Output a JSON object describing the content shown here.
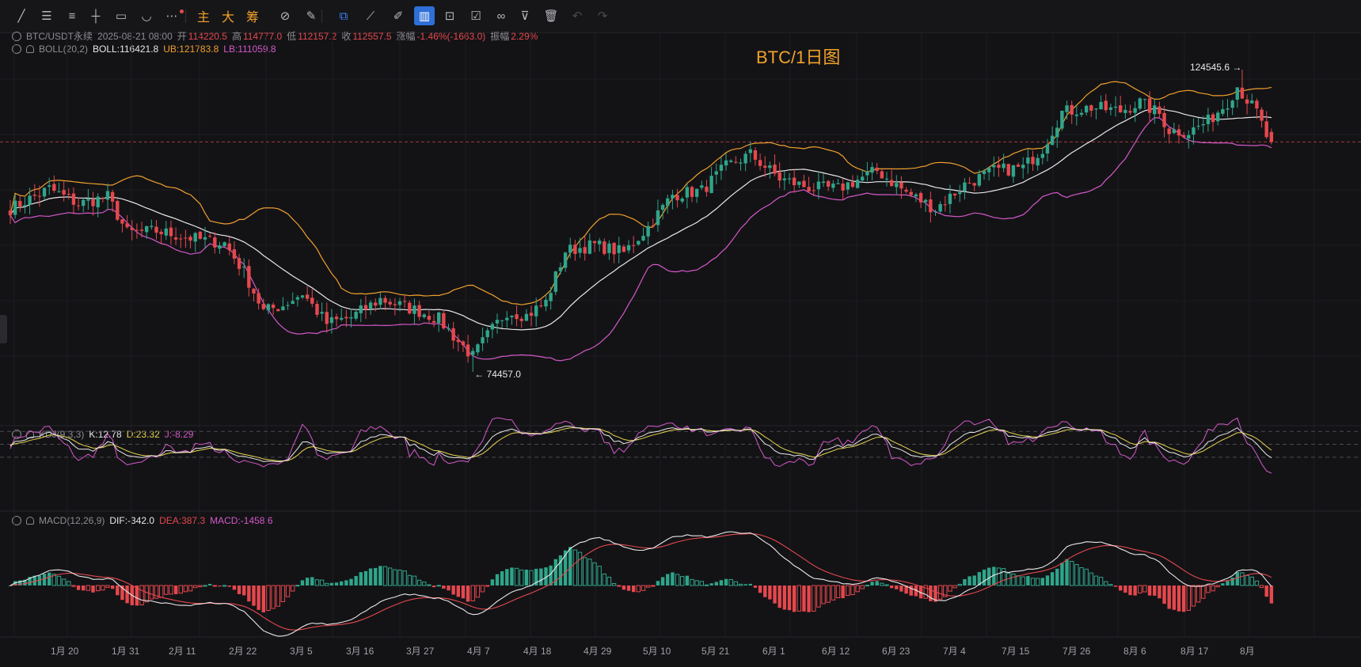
{
  "toolbar": {
    "tools": [
      {
        "name": "trend-line-icon",
        "glyph": "╱"
      },
      {
        "name": "parallel-lines-icon",
        "glyph": "☰"
      },
      {
        "name": "horizontal-lines-icon",
        "glyph": "≡"
      },
      {
        "name": "horizontal-ray-icon",
        "glyph": "┼"
      },
      {
        "name": "rectangle-icon",
        "glyph": "▭"
      },
      {
        "name": "curve-icon",
        "glyph": "◡"
      },
      {
        "name": "more-tools-icon",
        "glyph": "⋯"
      },
      {
        "name": "main-chart-button",
        "glyph": "主"
      },
      {
        "name": "large-button",
        "glyph": "大"
      },
      {
        "name": "chips-button",
        "glyph": "筹"
      },
      {
        "name": "magnet-icon",
        "glyph": "⊘"
      },
      {
        "name": "draw-toggle-icon",
        "glyph": "✎"
      },
      {
        "name": "copy-icon",
        "glyph": "⧉"
      },
      {
        "name": "ruler-icon",
        "glyph": "⟋"
      },
      {
        "name": "pen-icon",
        "glyph": "✐"
      },
      {
        "name": "candles-icon",
        "glyph": "▥"
      },
      {
        "name": "lock-icon",
        "glyph": "⊡"
      },
      {
        "name": "notes-icon",
        "glyph": "☑"
      },
      {
        "name": "link-icon",
        "glyph": "∞"
      },
      {
        "name": "filter-icon",
        "glyph": "⊽"
      },
      {
        "name": "delete-icon",
        "glyph": "🗑"
      },
      {
        "name": "undo-icon",
        "glyph": "↶"
      },
      {
        "name": "redo-icon",
        "glyph": "↷"
      }
    ]
  },
  "header": {
    "symbol": "BTC/USDT永续",
    "datetime": "2025-08-21 08:00",
    "open_label": "开",
    "open": "114220.5",
    "high_label": "高",
    "high": "114777.0",
    "low_label": "低",
    "low": "112157.2",
    "close_label": "收",
    "close": "112557.5",
    "change_label": "涨幅",
    "change": "-1.46%(-1663.0)",
    "amplitude_label": "振幅",
    "amplitude": "2.29%"
  },
  "boll": {
    "name": "BOLL(20,2)",
    "mid": "BOLL:116421.8",
    "ub": "UB:121783.8",
    "lb": "LB:111059.8"
  },
  "kdj": {
    "name": "KDJ(9,3,3)",
    "k": "K:12.78",
    "d": "D:23.32",
    "j": "J:-8.29"
  },
  "macd": {
    "name": "MACD(12,26,9)",
    "dif": "DIF:-342.0",
    "dea": "DEA:387.3",
    "macd": "MACD:-1458.6"
  },
  "chart_title": "BTC/1日图",
  "annotations": {
    "high": "124545.6 →",
    "low": "← 74457.0"
  },
  "colors": {
    "up": "#2fa58a",
    "down": "#e5484d",
    "boll_mid": "#e8e8ea",
    "boll_ub": "#f0a02c",
    "boll_lb": "#d558c8",
    "accent": "#f2a22a"
  },
  "chart_data": {
    "type": "candlestick",
    "x_ticks": [
      "1月 20",
      "1月 31",
      "2月 11",
      "2月 22",
      "3月 5",
      "3月 16",
      "3月 27",
      "4月 7",
      "4月 18",
      "4月 29",
      "5月 10",
      "5月 21",
      "6月 1",
      "6月 12",
      "6月 23",
      "7月 4",
      "7月 15",
      "7月 26",
      "8月 6",
      "8月 17",
      "8月"
    ],
    "close_anchors": [
      [
        0,
        101500
      ],
      [
        8,
        104800
      ],
      [
        14,
        102300
      ],
      [
        20,
        103500
      ],
      [
        24,
        97500
      ],
      [
        30,
        97800
      ],
      [
        38,
        96500
      ],
      [
        44,
        95800
      ],
      [
        48,
        91000
      ],
      [
        52,
        84500
      ],
      [
        56,
        85500
      ],
      [
        60,
        87500
      ],
      [
        65,
        82500
      ],
      [
        70,
        83500
      ],
      [
        76,
        86500
      ],
      [
        84,
        84500
      ],
      [
        88,
        83200
      ],
      [
        92,
        79500
      ],
      [
        95,
        77000
      ],
      [
        98,
        80500
      ],
      [
        102,
        84500
      ],
      [
        106,
        83800
      ],
      [
        110,
        86000
      ],
      [
        114,
        94500
      ],
      [
        120,
        95500
      ],
      [
        126,
        94200
      ],
      [
        131,
        98500
      ],
      [
        136,
        103800
      ],
      [
        142,
        104500
      ],
      [
        147,
        108500
      ],
      [
        152,
        110500
      ],
      [
        158,
        106500
      ],
      [
        164,
        105000
      ],
      [
        170,
        104800
      ],
      [
        178,
        107800
      ],
      [
        184,
        104200
      ],
      [
        190,
        101500
      ],
      [
        196,
        105500
      ],
      [
        202,
        107800
      ],
      [
        208,
        108300
      ],
      [
        212,
        111500
      ],
      [
        216,
        117500
      ],
      [
        222,
        118300
      ],
      [
        228,
        117700
      ],
      [
        232,
        119100
      ],
      [
        236,
        117200
      ],
      [
        238,
        114500
      ],
      [
        242,
        114200
      ],
      [
        246,
        116000
      ],
      [
        250,
        119200
      ],
      [
        252,
        121800
      ],
      [
        254,
        119500
      ],
      [
        256,
        117500
      ],
      [
        258,
        113500
      ],
      [
        259,
        112557
      ]
    ],
    "boll_period": 20,
    "kdj_params": [
      9,
      3,
      3
    ],
    "macd_params": [
      12,
      26,
      9
    ],
    "last": {
      "open": 114220.5,
      "high": 114777.0,
      "low": 112157.2,
      "close": 112557.5
    },
    "extremes": {
      "high": 124545.6,
      "low": 74457.0
    },
    "current_price": 112557.5
  }
}
